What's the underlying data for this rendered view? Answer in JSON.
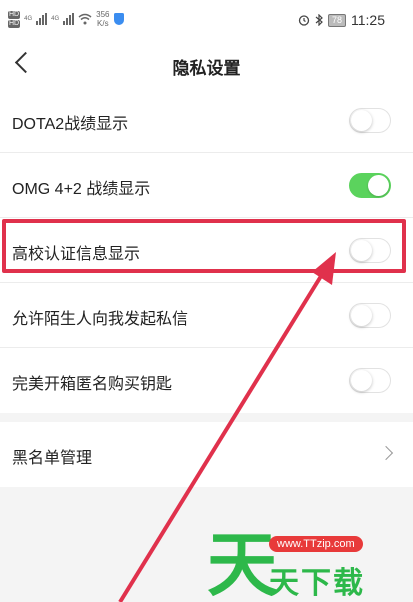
{
  "status_bar": {
    "sim1": "HD",
    "sim2": "HD",
    "net1": "4G",
    "net2": "4G",
    "speed": "356",
    "speed_unit": "K/s",
    "battery": "78",
    "time": "11:25"
  },
  "header": {
    "title": "隐私设置"
  },
  "settings": [
    {
      "label": "DOTA2战绩显示",
      "enabled": false
    },
    {
      "label": "OMG 4+2 战绩显示",
      "enabled": true
    },
    {
      "label": "高校认证信息显示",
      "enabled": false
    },
    {
      "label": "允许陌生人向我发起私信",
      "enabled": false
    },
    {
      "label": "完美开箱匿名购买钥匙",
      "enabled": false
    }
  ],
  "blacklist": {
    "label": "黑名单管理"
  },
  "colors": {
    "toggle_on": "#5bd35d",
    "highlight": "#e0314c"
  },
  "watermark": {
    "url": "www.TTzip.com",
    "big_char": "天",
    "text": "天下载"
  }
}
